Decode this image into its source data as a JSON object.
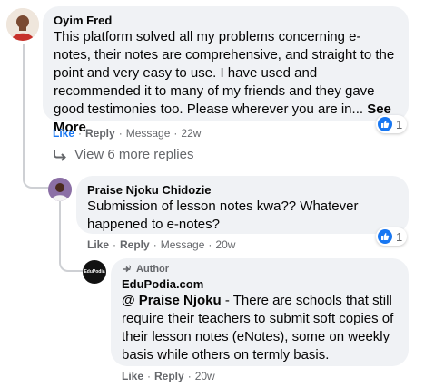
{
  "comment1": {
    "author": "Oyim Fred",
    "text": "This platform solved all my problems concerning e-notes, their notes are comprehensive, and straight to the point and very easy to use. I have used and recommended it to many of my friends and they gave good testimonies too. Please wherever you are in...",
    "see_more": "See More",
    "actions": {
      "like": "Like",
      "reply": "Reply",
      "message": "Message",
      "time": "22w"
    },
    "reaction_count": "1"
  },
  "view_replies": {
    "label": "View 6 more replies"
  },
  "comment2": {
    "author": "Praise Njoku Chidozie",
    "text": "Submission of lesson notes kwa?? Whatever happened to e-notes?",
    "actions": {
      "like": "Like",
      "reply": "Reply",
      "message": "Message",
      "time": "20w"
    },
    "reaction_count": "1"
  },
  "comment3": {
    "badge": "Author",
    "author": "EduPodia.com",
    "avatar_text": "EduPodia",
    "mention": "@ Praise Njoku",
    "text": " - There are schools that still require their teachers to submit soft copies of their lesson notes (eNotes), some on weekly basis while others on termly basis.",
    "actions": {
      "like": "Like",
      "reply": "Reply",
      "time": "20w"
    }
  },
  "colors": {
    "like_blue": "#1877f2",
    "bubble": "#f0f2f5",
    "meta": "#65676b"
  }
}
